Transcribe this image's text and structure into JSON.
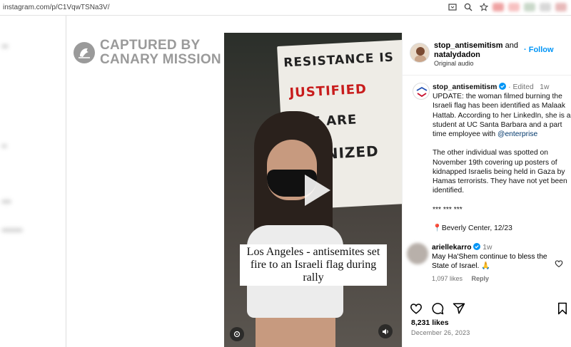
{
  "browser": {
    "url": "instagram.com/p/C1VqwTSNa3V/"
  },
  "watermark": {
    "line1": "CAPTURED BY",
    "line2": "CANARY MISSION"
  },
  "video": {
    "sign_lines": [
      "RESISTANCE IS",
      "JUSTIFIED",
      "OPLE ARE",
      "COLONIZED"
    ],
    "caption": "Los Angeles - antisemites set fire to an Israeli flag during rally"
  },
  "post_header": {
    "author1": "stop_antisemitism",
    "joiner": " and",
    "author2": "natalydadon",
    "audio": "Original audio",
    "follow_label": "Follow"
  },
  "post": {
    "author": "stop_antisemitism",
    "edited": "Edited",
    "age": "1w",
    "para1_prefix": "UPDATE: the woman filmed burning the Israeli flag has been identified as Malaak Hattab. According to her LinkedIn, she is a student at UC Santa Barbara and a part time employee with ",
    "para1_mention": "@enterprise",
    "para2": "The other individual was spotted on November 19th covering up posters of kidnapped Israelis being held in Gaza by Hamas terrorists. They have not yet been identified.",
    "separator": "*** *** ***",
    "location": "Beverly Center, 12/23"
  },
  "comment": {
    "author": "ariellekarro",
    "age": "1w",
    "text": "May Ha'Shem continue to bless the State of Israel. 🙏",
    "likes": "1,097 likes",
    "reply_label": "Reply"
  },
  "footer": {
    "likes": "8,231 likes",
    "date": "December 26, 2023"
  },
  "colors": {
    "accent": "#0095f6",
    "verified": "#0095f6",
    "muted": "#737373"
  }
}
